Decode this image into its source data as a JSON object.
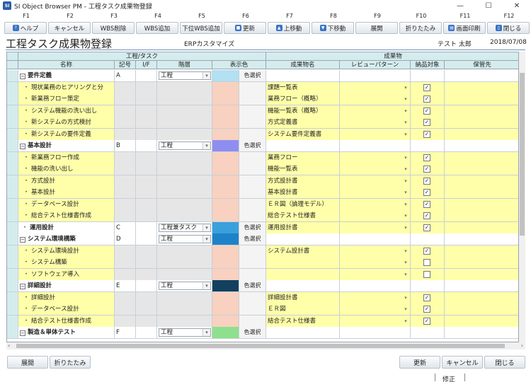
{
  "window": {
    "title": "SI Object Browser PM - 工程タスク成果物登録",
    "app_icon": "SI"
  },
  "fkeys": [
    "F1",
    "F2",
    "F3",
    "F4",
    "F5",
    "F6",
    "F7",
    "F8",
    "F9",
    "F10",
    "F11",
    "F12"
  ],
  "toolbar": [
    {
      "label": "ヘルプ",
      "icon": "help-icon"
    },
    {
      "label": "キャンセル",
      "icon": ""
    },
    {
      "label": "WBS削除",
      "icon": ""
    },
    {
      "label": "WBS追加",
      "icon": ""
    },
    {
      "label": "下位WBS追加",
      "icon": ""
    },
    {
      "label": "更新",
      "icon": "save-icon"
    },
    {
      "label": "上移動",
      "icon": "arrow-up-icon"
    },
    {
      "label": "下移動",
      "icon": "arrow-down-icon"
    },
    {
      "label": "展開",
      "icon": ""
    },
    {
      "label": "折りたたみ",
      "icon": ""
    },
    {
      "label": "画面印刷",
      "icon": "print-icon"
    },
    {
      "label": "閉じる",
      "icon": "door-icon"
    }
  ],
  "header": {
    "title": "工程タスク成果物登録",
    "project": "ERPカスタマイズ",
    "user": "テスト 太郎",
    "date": "2018/07/08"
  },
  "grid": {
    "group_headers": {
      "process": "工程/タスク",
      "deliverable": "成果物"
    },
    "columns": {
      "name": "名称",
      "code": "記号",
      "if": "I/F",
      "level": "階層",
      "color": "表示色",
      "deliverable": "成果物名",
      "review": "レビューパターン",
      "include": "納品対象",
      "save": "保管先"
    },
    "pick_label": "色選択",
    "rows": [
      {
        "type": "phase",
        "name": "要件定義",
        "code": "A",
        "level": "工程",
        "color": "#b3e0f2",
        "deliverable": "",
        "check": null
      },
      {
        "type": "task",
        "name": "現状業務のヒアリングと分",
        "deliverable": "課題一覧表",
        "check": true
      },
      {
        "type": "task",
        "name": "新業務フロー策定",
        "deliverable": "業務フロー（概略）",
        "check": true
      },
      {
        "type": "task",
        "name": "システム機能の洗い出し",
        "deliverable": "機能一覧表（概略）",
        "check": true
      },
      {
        "type": "task",
        "name": "新システムの方式検討",
        "deliverable": "方式定義書",
        "check": true
      },
      {
        "type": "task",
        "name": "新システムの要件定義",
        "deliverable": "システム要件定義書",
        "check": true
      },
      {
        "type": "phase",
        "name": "基本設計",
        "code": "B",
        "level": "工程",
        "color": "#8e8ef0",
        "deliverable": "",
        "check": null
      },
      {
        "type": "task",
        "name": "新業務フロー作成",
        "deliverable": "業務フロー",
        "check": true
      },
      {
        "type": "task",
        "name": "機能の洗い出し",
        "deliverable": "機能一覧表",
        "check": true
      },
      {
        "type": "task",
        "name": "方式設計",
        "deliverable": "方式設計書",
        "check": true
      },
      {
        "type": "task",
        "name": "基本設計",
        "deliverable": "基本設計書",
        "check": true
      },
      {
        "type": "task",
        "name": "データベース設計",
        "deliverable": "ＥＲ図（論理モデル）",
        "check": true
      },
      {
        "type": "task",
        "name": "総合テスト仕様書作成",
        "deliverable": "総合テスト仕様書",
        "check": true
      },
      {
        "type": "phase-single",
        "name": "運用設計",
        "code": "C",
        "level": "工程兼タスク",
        "color": "#3aa0db",
        "deliverable": "運用設計書",
        "check": true
      },
      {
        "type": "phase",
        "name": "システム環境構築",
        "code": "D",
        "level": "工程",
        "color": "#1e82c8",
        "deliverable": "",
        "check": null
      },
      {
        "type": "task",
        "name": "システム環境設計",
        "deliverable": "システム設計書",
        "check": true
      },
      {
        "type": "task",
        "name": "システム構築",
        "deliverable": "",
        "check": false
      },
      {
        "type": "task",
        "name": "ソフトウェア導入",
        "deliverable": "",
        "check": false
      },
      {
        "type": "phase",
        "name": "詳細設計",
        "code": "E",
        "level": "工程",
        "color": "#12405e",
        "deliverable": "",
        "check": null
      },
      {
        "type": "task",
        "name": "詳細設計",
        "deliverable": "詳細設計書",
        "check": true
      },
      {
        "type": "task",
        "name": "データベース設計",
        "deliverable": "ＥＲ図",
        "check": true
      },
      {
        "type": "task",
        "name": "結合テスト仕様書作成",
        "deliverable": "結合テスト仕様書",
        "check": true
      },
      {
        "type": "phase",
        "name": "製造＆単体テスト",
        "code": "F",
        "level": "工程",
        "color": "#8ee08e",
        "deliverable": "",
        "check": null
      }
    ]
  },
  "bottom": {
    "expand": "展開",
    "collapse": "折りたたみ",
    "update": "更新",
    "cancel": "キャンセル",
    "close": "閉じる"
  },
  "status": {
    "text": "修正"
  }
}
